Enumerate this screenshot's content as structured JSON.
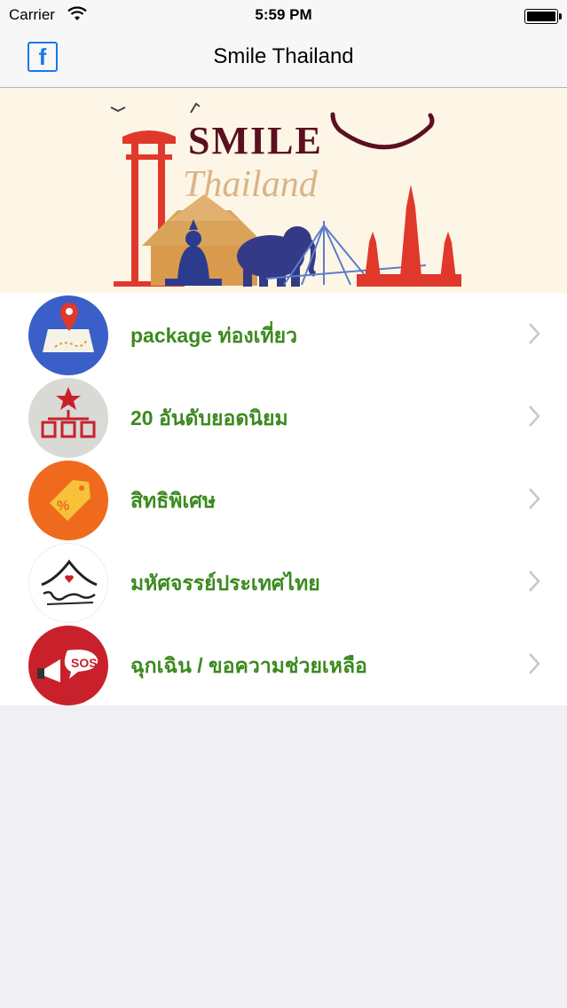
{
  "status": {
    "carrier": "Carrier",
    "time": "5:59 PM"
  },
  "nav": {
    "title": "Smile Thailand",
    "fb_glyph": "f"
  },
  "banner": {
    "line1": "SMILE",
    "line2": "Thailand"
  },
  "menu": [
    {
      "label": "package ท่องเที่ยว",
      "icon": "map-pin-icon",
      "color": "#3b5fc8"
    },
    {
      "label": "20 อันดับยอดนิยม",
      "icon": "ranking-icon",
      "color": "#d9d9d6"
    },
    {
      "label": "สิทธิพิเศษ",
      "icon": "discount-tag-icon",
      "color": "#f06a1e"
    },
    {
      "label": "มหัศจรรย์ประเทศไทย",
      "icon": "thailand-logo-icon",
      "color": "#ffffff"
    },
    {
      "label": "ฉุกเฉิน / ขอความช่วยเหลือ",
      "icon": "sos-megaphone-icon",
      "color": "#c8212b"
    }
  ],
  "colors": {
    "label": "#3b8a1f",
    "accent": "#1877f2"
  }
}
